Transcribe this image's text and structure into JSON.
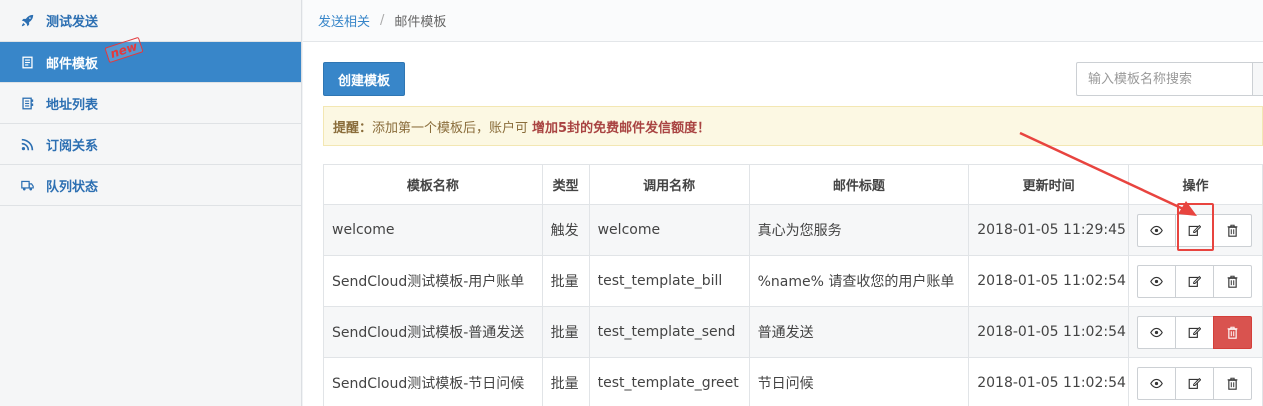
{
  "sidebar": {
    "items": [
      {
        "label": "测试发送",
        "icon": "rocket-icon"
      },
      {
        "label": "邮件模板",
        "icon": "document-icon",
        "active": true,
        "badge": "new"
      },
      {
        "label": "地址列表",
        "icon": "address-book-icon"
      },
      {
        "label": "订阅关系",
        "icon": "rss-icon"
      },
      {
        "label": "队列状态",
        "icon": "truck-icon"
      }
    ]
  },
  "breadcrumb": {
    "parent": "发送相关",
    "separator": "/",
    "current": "邮件模板"
  },
  "toolbar": {
    "create_label": "创建模板",
    "search_placeholder": "输入模板名称搜索"
  },
  "alert": {
    "title": "提醒：",
    "text": "添加第一个模板后，账户可",
    "strong": "增加5封的免费邮件发信额度！"
  },
  "table": {
    "headers": [
      "模板名称",
      "类型",
      "调用名称",
      "邮件标题",
      "更新时间",
      "操作"
    ],
    "rows": [
      {
        "name": "welcome",
        "type": "触发",
        "call_name": "welcome",
        "subject": "真心为您服务",
        "updated": "2018-01-05 11:29:45"
      },
      {
        "name": "SendCloud测试模板-用户账单",
        "type": "批量",
        "call_name": "test_template_bill",
        "subject": "%name% 请查收您的用户账单",
        "updated": "2018-01-05 11:02:54"
      },
      {
        "name": "SendCloud测试模板-普通发送",
        "type": "批量",
        "call_name": "test_template_send",
        "subject": "普通发送",
        "updated": "2018-01-05 11:02:54"
      },
      {
        "name": "SendCloud测试模板-节日问候",
        "type": "批量",
        "call_name": "test_template_greet",
        "subject": "节日问候",
        "updated": "2018-01-05 11:02:54"
      }
    ],
    "row_actions": [
      "eye-icon",
      "edit-icon",
      "trash-icon"
    ]
  },
  "colors": {
    "accent": "#3886c9",
    "danger": "#d9534f",
    "annotation": "#e8443f",
    "alert_bg": "#fcf8e3"
  }
}
